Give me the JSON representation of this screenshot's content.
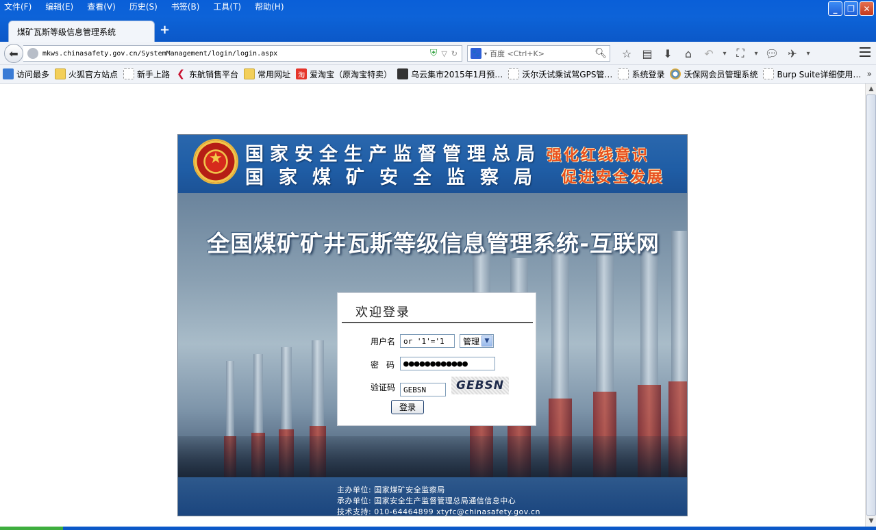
{
  "menu": [
    "文件(F)",
    "编辑(E)",
    "查看(V)",
    "历史(S)",
    "书签(B)",
    "工具(T)",
    "帮助(H)"
  ],
  "tab": {
    "title": "煤矿瓦斯等级信息管理系统",
    "new_tab": "+"
  },
  "window_controls": {
    "minimize": "_",
    "maximize": "❐",
    "close": "✕"
  },
  "nav": {
    "url": "mkws.chinasafety.gov.cn/SystemManagement/login/login.aspx",
    "search_engine": "百度",
    "search_placeholder": "百度 <Ctrl+K>"
  },
  "bookmarks": [
    {
      "label": "访问最多",
      "icon": "search-folder"
    },
    {
      "label": "火狐官方站点",
      "icon": "folder"
    },
    {
      "label": "新手上路",
      "icon": "page"
    },
    {
      "label": "东航销售平台",
      "icon": "airline"
    },
    {
      "label": "常用网址",
      "icon": "folder"
    },
    {
      "label": "爱淘宝（原淘宝特卖）",
      "icon": "taobao"
    },
    {
      "label": "乌云集市2015年1月预…",
      "icon": "dark"
    },
    {
      "label": "沃尔沃试乘试驾GPS管…",
      "icon": "blue"
    },
    {
      "label": "系统登录",
      "icon": "page"
    },
    {
      "label": "沃保网会员管理系统",
      "icon": "ie"
    },
    {
      "label": "Burp Suite详细使用…",
      "icon": "page"
    }
  ],
  "bookmarks_more": "»",
  "page": {
    "agency_line1": "国家安全生产监督管理总局",
    "agency_line2": "国家煤矿安全监察局",
    "slogan_line1": "强化红线意识",
    "slogan_line2": "促进安全发展",
    "system_title": "全国煤矿矿井瓦斯等级信息管理系统-互联网",
    "login": {
      "heading": "欢迎登录",
      "username_label": "用户名",
      "username_value": " or '1'='1",
      "role_value": "管理",
      "password_label": "密码",
      "password_value": "●●●●●●●●●●●●",
      "captcha_label": "验证码",
      "captcha_value": "GEBSN",
      "captcha_image_text": "GEBSN",
      "submit": "登录"
    },
    "footer": {
      "host": "主办单位: 国家煤矿安全监察局",
      "organizer": "承办单位: 国家安全生产监督管理总局通信信息中心",
      "support": "技术支持: 010-64464899  xtyfc@chinasafety.gov.cn"
    }
  },
  "colors": {
    "titlebar": "#0d63d8",
    "header_band": "#1f5da5",
    "slogan": "#e8501e"
  }
}
